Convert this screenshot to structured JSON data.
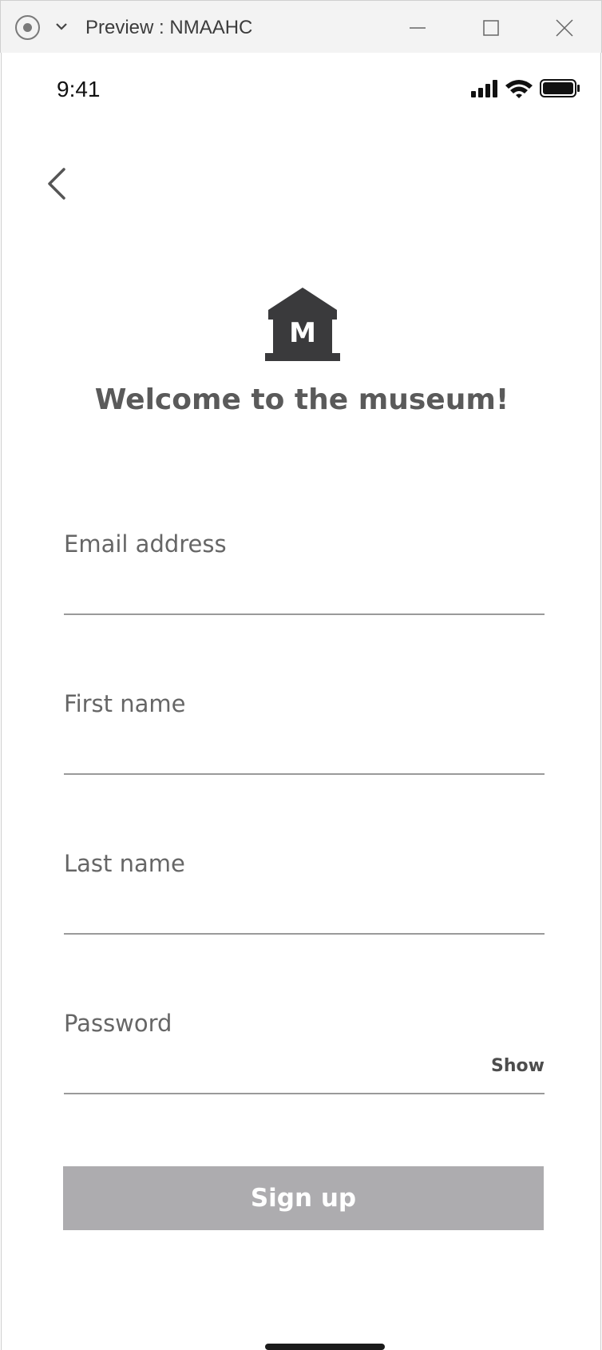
{
  "window": {
    "title": "Preview : NMAAHC"
  },
  "status_bar": {
    "time": "9:41",
    "icons": [
      "cellular-signal-icon",
      "wifi-icon",
      "battery-icon"
    ]
  },
  "screen": {
    "back_icon": "chevron-left-icon",
    "logo_letter": "M",
    "heading": "Welcome to the museum!"
  },
  "form": {
    "email_label": "Email address",
    "email_value": "",
    "first_name_label": "First name",
    "first_name_value": "",
    "last_name_label": "Last name",
    "last_name_value": "",
    "password_label": "Password",
    "password_value": "",
    "show_label": "Show",
    "submit_label": "Sign up"
  },
  "colors": {
    "button_bg": "#adacaf",
    "text": "#5f5f5f",
    "logo": "#3a3a3c"
  }
}
